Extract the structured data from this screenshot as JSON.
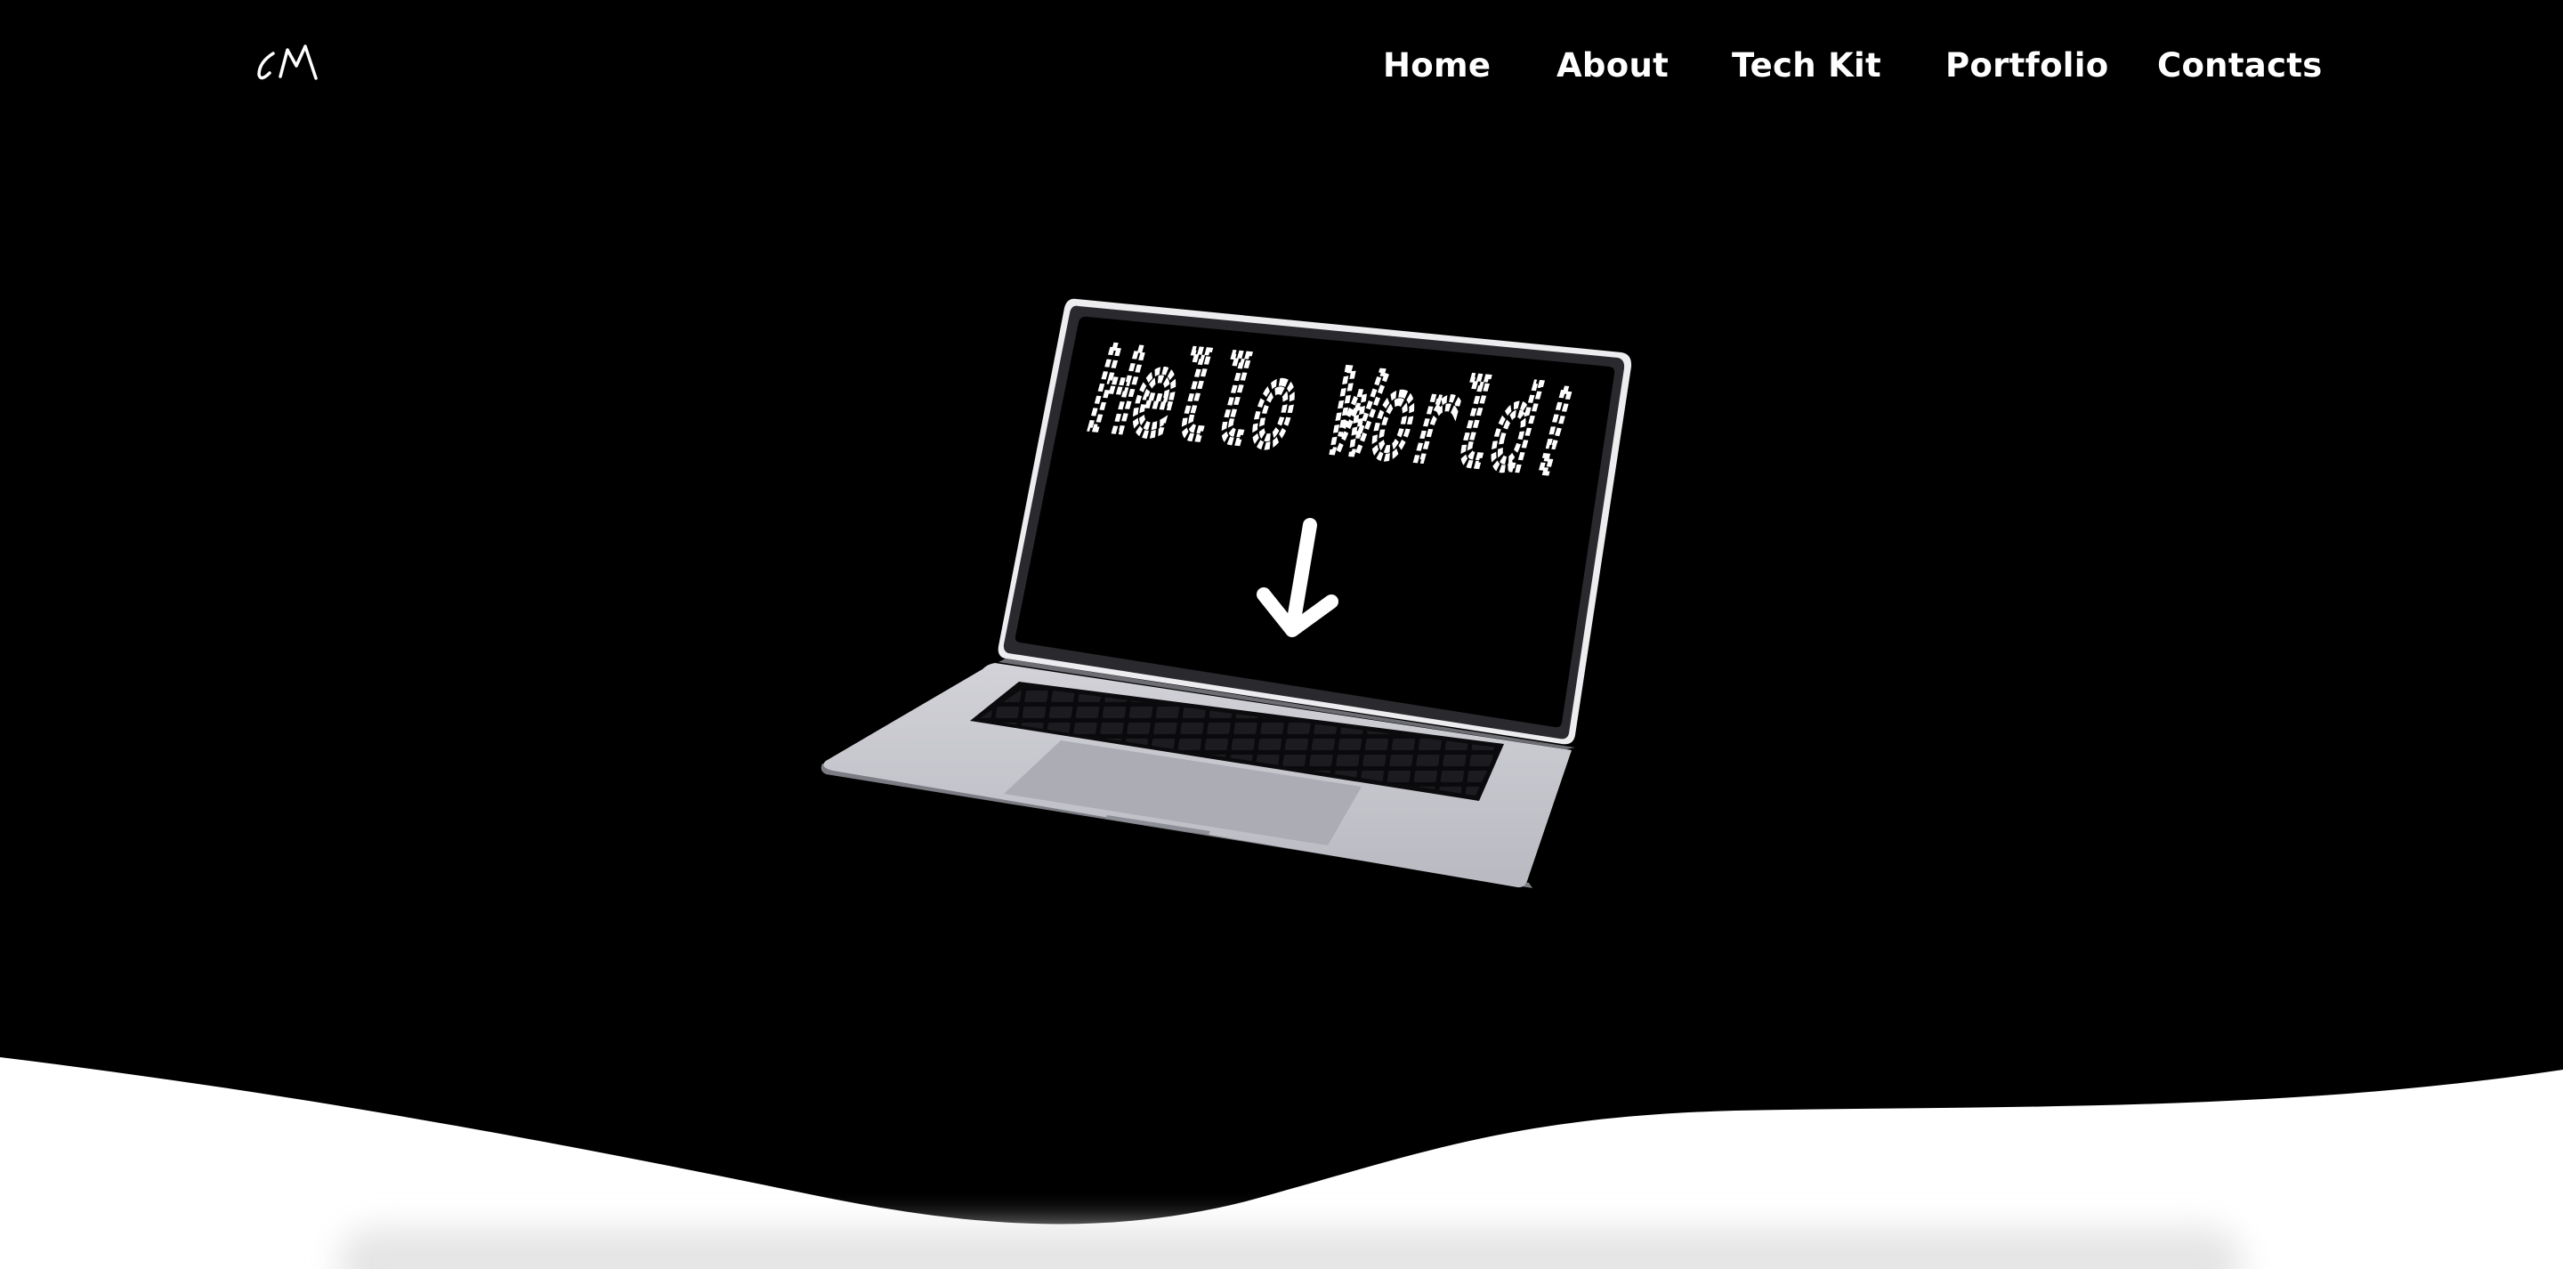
{
  "logo": {
    "text": "CM",
    "icon": "signature-logo"
  },
  "nav": {
    "items": [
      {
        "label": "Home"
      },
      {
        "label": "About"
      },
      {
        "label": "Tech Kit"
      },
      {
        "label": "Portfolio"
      },
      {
        "label": "Contacts"
      }
    ]
  },
  "hero": {
    "screen_text": "Hello World!",
    "screen_icon": "down-arrow-icon"
  },
  "colors": {
    "background": "#000000",
    "wave": "#ffffff",
    "nav_text": "#ffffff",
    "laptop_body": "#c4c4cc"
  }
}
